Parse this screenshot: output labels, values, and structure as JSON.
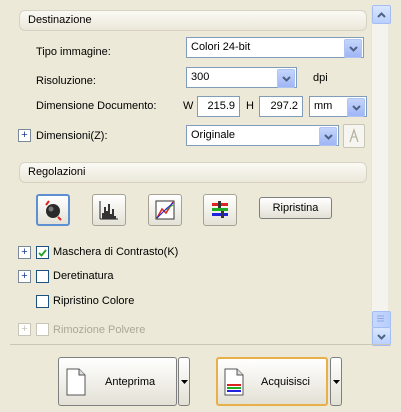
{
  "destinazione": {
    "header": "Destinazione",
    "tipo_immagine_label": "Tipo immagine:",
    "tipo_immagine_value": "Colori 24-bit",
    "risoluzione_label": "Risoluzione:",
    "risoluzione_value": "300",
    "dpi_unit": "dpi",
    "dimensione_label": "Dimensione Documento:",
    "w_label": "W",
    "w_value": "215.9",
    "h_label": "H",
    "h_value": "297.2",
    "unit_value": "mm",
    "dimensioni_label": "Dimensioni(Z):",
    "dimensioni_value": "Originale"
  },
  "regolazioni": {
    "header": "Regolazioni",
    "ripristina_label": "Ripristina",
    "options": [
      {
        "label": "Maschera di Contrasto(K)",
        "checked": true,
        "enabled": true
      },
      {
        "label": "Deretinatura",
        "checked": false,
        "enabled": true
      },
      {
        "label": "Ripristino Colore",
        "checked": false,
        "enabled": true
      },
      {
        "label": "Rimozione Polvere",
        "checked": false,
        "enabled": false
      }
    ]
  },
  "footer": {
    "anteprima_label": "Anteprima",
    "acquisisci_label": "Acquisisci"
  },
  "colors": {
    "accent_blue": "#1c5180",
    "panel_bg": "#ece9d8",
    "scroll_blue": "#b9cffb"
  },
  "icons": [
    "expand-plus-icon",
    "auto-exposure-icon",
    "histogram-icon",
    "tone-curve-icon",
    "color-adjust-icon",
    "lock-aspect-icon",
    "document-icon",
    "scan-document-icon"
  ]
}
